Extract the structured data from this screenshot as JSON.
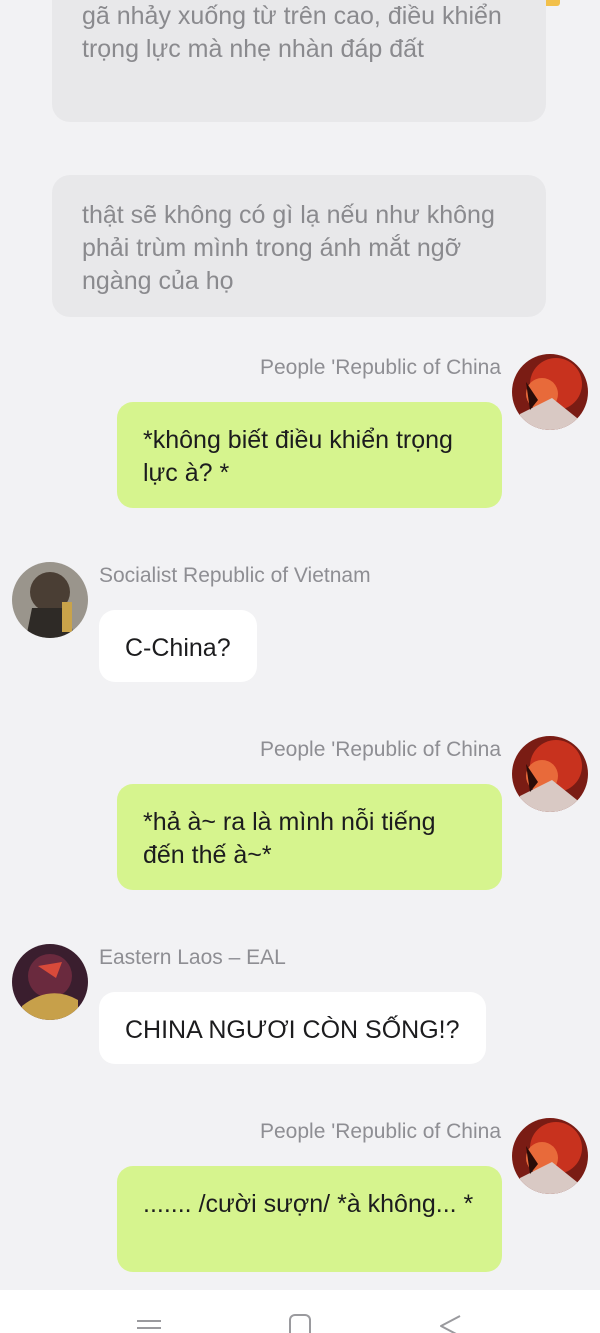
{
  "narrations": [
    {
      "text": "gã nhảy xuống từ trên cao, điều khiển trọng lực mà nhẹ nhàn đáp đất"
    },
    {
      "text": "thật sẽ không có gì lạ nếu như không phải trùm mình trong ánh mắt ngỡ ngàng của họ"
    }
  ],
  "messages": [
    {
      "sender": "People 'Republic of China",
      "text": "*không biết điều khiển trọng lực à? *"
    },
    {
      "sender": "Socialist Republic of Vietnam",
      "text": "C-China?"
    },
    {
      "sender": "People 'Republic of China",
      "text": "*hả à~ ra là mình nỗi tiếng đến thế à~*"
    },
    {
      "sender": "Eastern Laos – EAL",
      "text": "CHINA NGƯƠI CÒN SỐNG!?"
    },
    {
      "sender": "People 'Republic of China",
      "text": "....... /cười sượn/ *à không... *"
    }
  ],
  "nav": {
    "menu_icon": "menu-icon",
    "home_icon": "home-icon",
    "back_icon": "back-icon"
  },
  "colors": {
    "self_bubble": "#d6f48e",
    "other_bubble": "#ffffff",
    "narration_bubble": "#e8e8ea",
    "background": "#f2f2f4"
  }
}
